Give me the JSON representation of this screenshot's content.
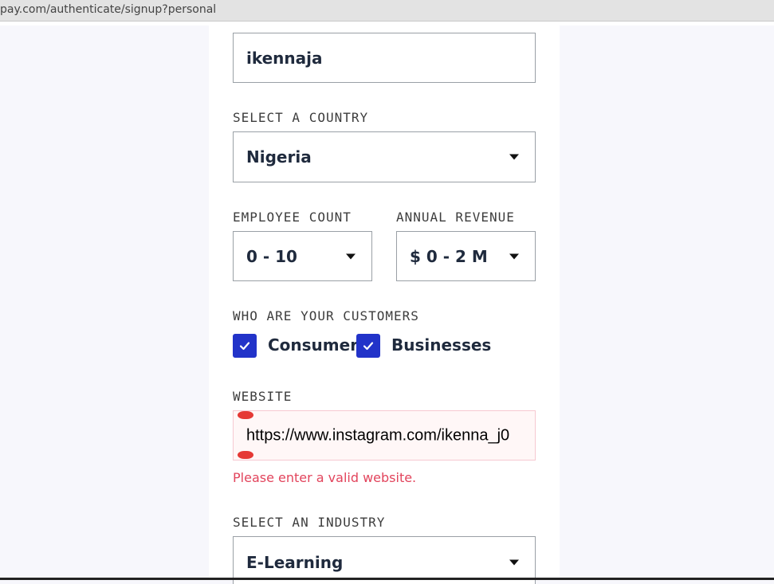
{
  "browser": {
    "url": "pay.com/authenticate/signup?personal"
  },
  "form": {
    "name_value": "ikennaja",
    "country": {
      "label": "SELECT A COUNTRY",
      "value": "Nigeria"
    },
    "employee_count": {
      "label": "EMPLOYEE COUNT",
      "value": "0 - 10"
    },
    "annual_revenue": {
      "label": "ANNUAL REVENUE",
      "value": "$ 0 - 2 M"
    },
    "customers": {
      "label": "WHO ARE YOUR CUSTOMERS",
      "options": [
        {
          "label": "Consumers",
          "checked": true
        },
        {
          "label": "Businesses",
          "checked": true
        }
      ]
    },
    "website": {
      "label": "WEBSITE",
      "value": "https://www.instagram.com/ikenna_j0",
      "error": "Please enter a valid website."
    },
    "industry": {
      "label": "SELECT AN INDUSTRY",
      "value": "E-Learning"
    }
  },
  "colors": {
    "checkbox": "#2233c9",
    "error_text": "#e2445c",
    "invalid_bg": "#fff7f7",
    "invalid_border": "#f6c9d1"
  }
}
